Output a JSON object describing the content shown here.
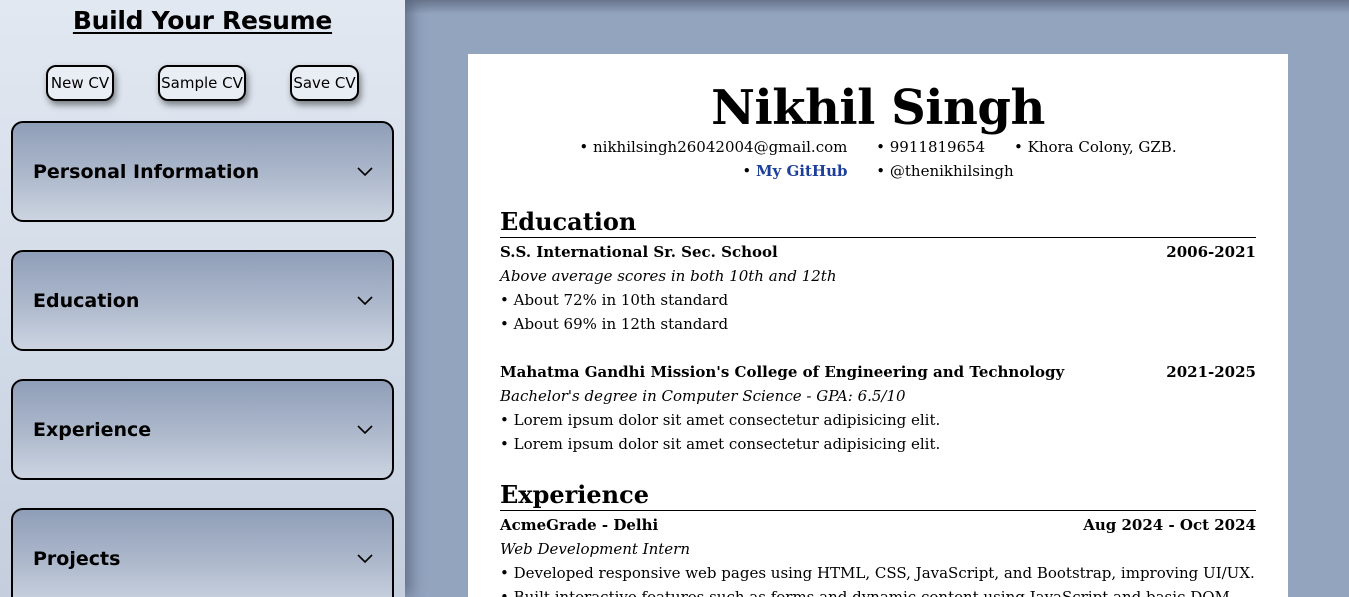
{
  "sidebar": {
    "title": "Build Your Resume",
    "buttons": {
      "new_cv": "New CV",
      "sample_cv": "Sample CV",
      "save_cv": "Save CV"
    },
    "sections": [
      {
        "label": "Personal Information",
        "icon": "chevron-down-icon"
      },
      {
        "label": "Education",
        "icon": "chevron-down-icon"
      },
      {
        "label": "Experience",
        "icon": "chevron-down-icon"
      },
      {
        "label": "Projects",
        "icon": "chevron-down-icon"
      }
    ]
  },
  "resume": {
    "name": "Nikhil Singh",
    "contact": {
      "email": "nikhilsingh26042004@gmail.com",
      "phone": "9911819654",
      "address": "Khora Colony, GZB.",
      "github": "My GitHub",
      "handle": "@thenikhilsingh"
    },
    "education": {
      "heading": "Education",
      "entries": [
        {
          "school": "S.S. International Sr. Sec. School",
          "years": "2006-2021",
          "subtitle": "Above average scores in both 10th and 12th",
          "bullets": [
            "About 72% in 10th standard",
            "About 69% in 12th standard"
          ]
        },
        {
          "school": "Mahatma Gandhi Mission's College of Engineering and Technology",
          "years": "2021-2025",
          "subtitle": "Bachelor's degree in Computer Science - GPA: 6.5/10",
          "bullets": [
            "Lorem ipsum dolor sit amet consectetur adipisicing elit.",
            "Lorem ipsum dolor sit amet consectetur adipisicing elit."
          ]
        }
      ]
    },
    "experience": {
      "heading": "Experience",
      "entries": [
        {
          "company": "AcmeGrade - Delhi",
          "dates": "Aug 2024 - Oct 2024",
          "role": "Web Development Intern",
          "bullets": [
            "Developed responsive web pages using HTML, CSS, JavaScript, and Bootstrap, improving UI/UX.",
            "Built interactive features such as forms and dynamic content using JavaScript and basic DOM"
          ]
        }
      ]
    }
  },
  "colors": {
    "background": "#93a4bf",
    "link": "#1d3f9a",
    "card_top": "#8f9eb8"
  }
}
